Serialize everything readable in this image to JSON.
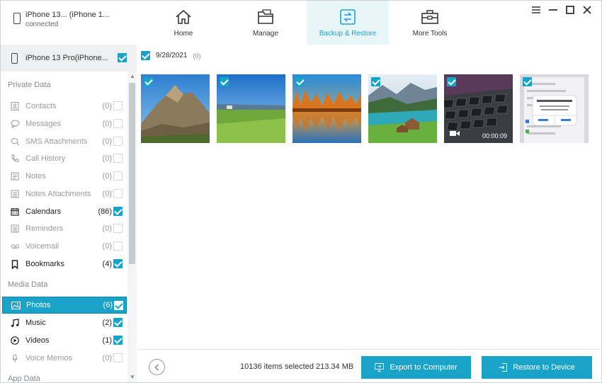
{
  "header": {
    "device_name": "iPhone 13... (iPhone 1...",
    "device_status": "connected",
    "tabs": [
      {
        "label": "Home",
        "icon": "home-icon"
      },
      {
        "label": "Manage",
        "icon": "folder-icon"
      },
      {
        "label": "Backup & Restore",
        "icon": "backup-restore-icon",
        "active": true
      },
      {
        "label": "More Tools",
        "icon": "toolbox-icon"
      }
    ],
    "window_controls": [
      "menu-icon",
      "minimize-icon",
      "maximize-icon",
      "close-icon"
    ]
  },
  "sidebar": {
    "device_label": "iPhone 13 Pro(iPhone...",
    "sections": [
      {
        "title": "Private Data",
        "items": [
          {
            "label": "Contacts",
            "count": "(0)",
            "icon": "contacts-icon",
            "checked": false,
            "enabled": false
          },
          {
            "label": "Messages",
            "count": "(0)",
            "icon": "messages-icon",
            "checked": false,
            "enabled": false
          },
          {
            "label": "SMS Attachments",
            "count": "(0)",
            "icon": "attachment-icon",
            "checked": false,
            "enabled": false
          },
          {
            "label": "Call History",
            "count": "(0)",
            "icon": "phone-icon",
            "checked": false,
            "enabled": false
          },
          {
            "label": "Notes",
            "count": "(0)",
            "icon": "notes-icon",
            "checked": false,
            "enabled": false
          },
          {
            "label": "Notes Attachments",
            "count": "(0)",
            "icon": "notes-attachment-icon",
            "checked": false,
            "enabled": false
          },
          {
            "label": "Calendars",
            "count": "(86)",
            "icon": "calendar-icon",
            "checked": true,
            "enabled": true
          },
          {
            "label": "Reminders",
            "count": "(0)",
            "icon": "reminders-icon",
            "checked": false,
            "enabled": false
          },
          {
            "label": "Voicemail",
            "count": "(0)",
            "icon": "voicemail-icon",
            "checked": false,
            "enabled": false
          },
          {
            "label": "Bookmarks",
            "count": "(4)",
            "icon": "bookmark-icon",
            "checked": true,
            "enabled": true
          }
        ]
      },
      {
        "title": "Media Data",
        "items": [
          {
            "label": "Photos",
            "count": "(6)",
            "icon": "photo-icon",
            "checked": true,
            "enabled": true,
            "selected": true
          },
          {
            "label": "Music",
            "count": "(2)",
            "icon": "music-icon",
            "checked": true,
            "enabled": true
          },
          {
            "label": "Videos",
            "count": "(1)",
            "icon": "video-play-icon",
            "checked": true,
            "enabled": true
          },
          {
            "label": "Voice Memos",
            "count": "(0)",
            "icon": "microphone-icon",
            "checked": false,
            "enabled": false
          }
        ]
      },
      {
        "title": "App Data",
        "items": []
      }
    ]
  },
  "main": {
    "date_group": {
      "date": "9/28/2021",
      "count": "(0)"
    },
    "thumbnails": [
      {
        "kind": "photo",
        "scene": "mountain"
      },
      {
        "kind": "photo",
        "scene": "meadow"
      },
      {
        "kind": "photo",
        "scene": "autumn-lake"
      },
      {
        "kind": "photo",
        "scene": "alpine-lake"
      },
      {
        "kind": "video",
        "scene": "keyboard",
        "duration": "00:00:09"
      },
      {
        "kind": "photo",
        "scene": "screenshot-dialog"
      }
    ]
  },
  "footer": {
    "summary": "10136 items selected 213.34 MB",
    "export_label": "Export to Computer",
    "restore_label": "Restore to Device"
  },
  "colors": {
    "accent": "#1aa3c8",
    "tab_active_bg": "#e8f6fa",
    "sidebar_device_bg": "#eef0f1"
  }
}
